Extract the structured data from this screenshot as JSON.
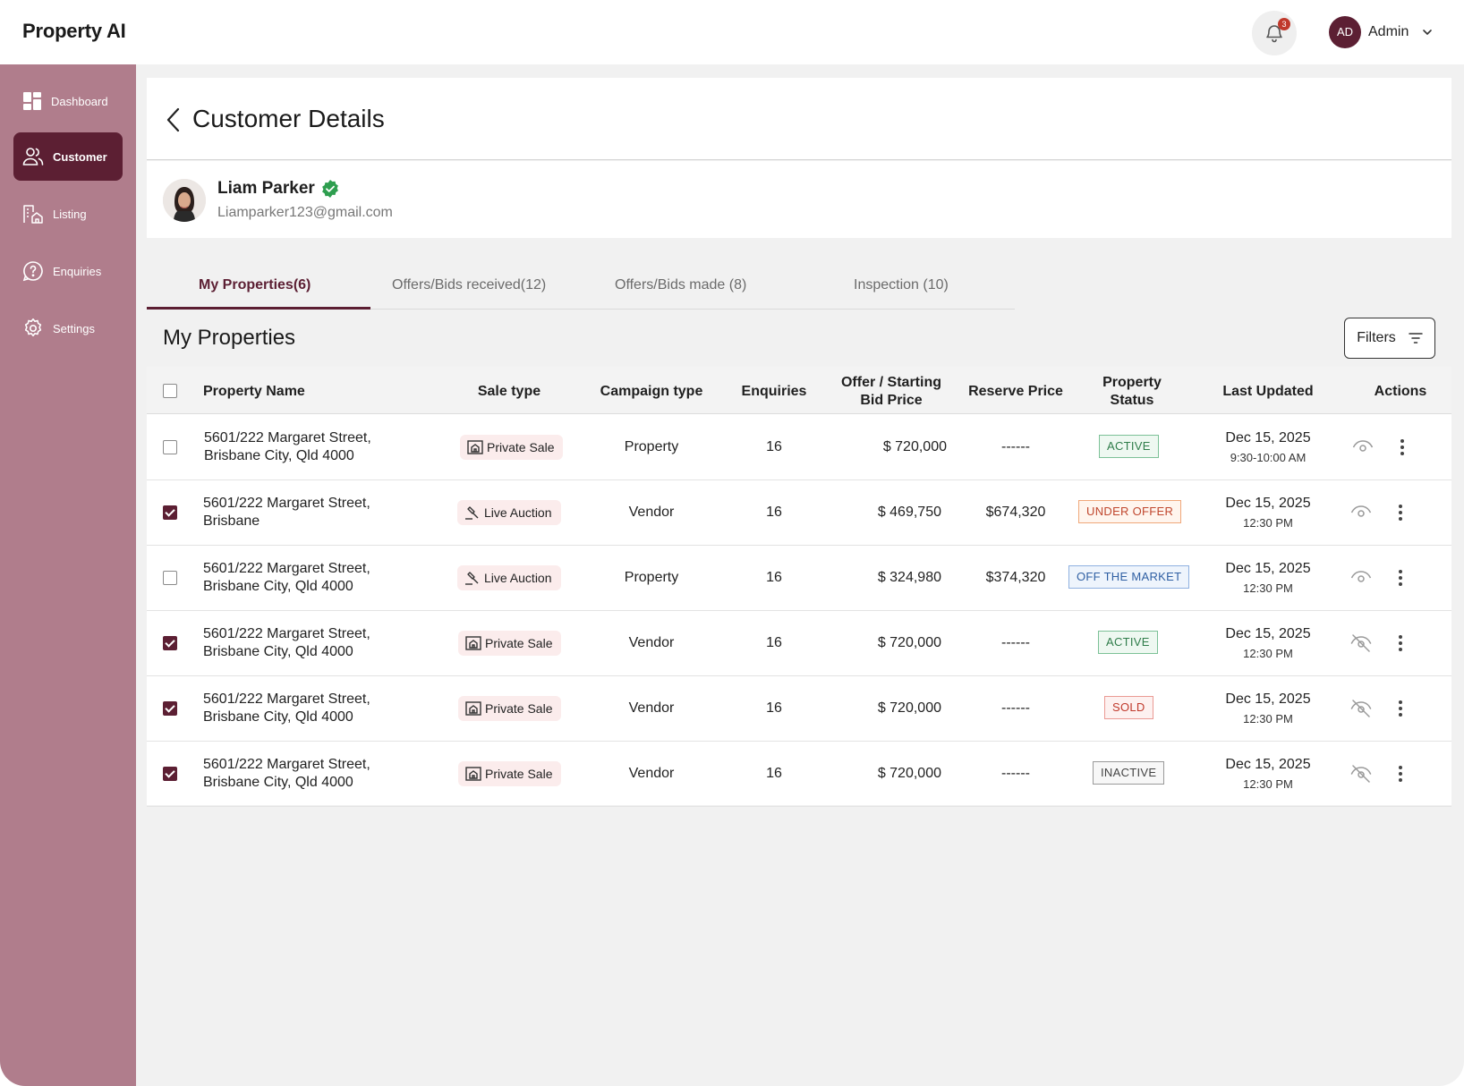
{
  "app": {
    "title": "Property AI"
  },
  "header": {
    "notification_count": "3",
    "user_initials": "AD",
    "user_name": "Admin"
  },
  "sidebar": {
    "items": [
      {
        "label": "Dashboard",
        "icon": "dashboard-icon",
        "active": false
      },
      {
        "label": "Customer",
        "icon": "users-icon",
        "active": true
      },
      {
        "label": "Listing",
        "icon": "building-icon",
        "active": false
      },
      {
        "label": "Enquiries",
        "icon": "question-icon",
        "active": false
      },
      {
        "label": "Settings",
        "icon": "gear-icon",
        "active": false
      }
    ]
  },
  "page": {
    "title": "Customer Details"
  },
  "customer": {
    "name": "Liam Parker",
    "email": "Liamparker123@gmail.com",
    "verified": true
  },
  "tabs": [
    {
      "label": "My Properties(6)",
      "active": true
    },
    {
      "label": "Offers/Bids received(12)",
      "active": false
    },
    {
      "label": "Offers/Bids made (8)",
      "active": false
    },
    {
      "label": "Inspection (10)",
      "active": false
    }
  ],
  "section": {
    "title": "My Properties",
    "filters_label": "Filters"
  },
  "table": {
    "headers": {
      "property_name": "Property Name",
      "sale_type": "Sale type",
      "campaign_type": "Campaign type",
      "enquiries": "Enquiries",
      "offer_line1": "Offer / Starting",
      "offer_line2": "Bid Price",
      "reserve_price": "Reserve Price",
      "status_line1": "Property",
      "status_line2": "Status",
      "last_updated": "Last Updated",
      "actions": "Actions"
    },
    "rows": [
      {
        "checked": false,
        "name1": "5601/222 Margaret Street,",
        "name2": "Brisbane City, Qld 4000",
        "sale_type": "Private Sale",
        "sale_icon": "house-icon",
        "campaign": "Property",
        "enquiries": "16",
        "offer": "$ 720,000",
        "reserve": "------",
        "status": "ACTIVE",
        "status_kind": "active",
        "date": "Dec 15, 2025",
        "time": "9:30-10:00 AM",
        "visible": true
      },
      {
        "checked": true,
        "name1": "5601/222 Margaret Street,",
        "name2": "Brisbane",
        "sale_type": "Live Auction",
        "sale_icon": "gavel-icon",
        "campaign": "Vendor",
        "enquiries": "16",
        "offer": "$ 469,750",
        "reserve": "$674,320",
        "status": "UNDER OFFER",
        "status_kind": "under",
        "date": "Dec 15, 2025",
        "time": "12:30 PM",
        "visible": true
      },
      {
        "checked": false,
        "name1": "5601/222 Margaret Street,",
        "name2": "Brisbane City, Qld 4000",
        "sale_type": "Live Auction",
        "sale_icon": "gavel-icon",
        "campaign": "Property",
        "enquiries": "16",
        "offer": "$ 324,980",
        "reserve": "$374,320",
        "status": "OFF THE MARKET",
        "status_kind": "off",
        "date": "Dec 15, 2025",
        "time": "12:30 PM",
        "visible": true
      },
      {
        "checked": true,
        "name1": "5601/222 Margaret Street,",
        "name2": "Brisbane City, Qld 4000",
        "sale_type": "Private Sale",
        "sale_icon": "house-icon",
        "campaign": "Vendor",
        "enquiries": "16",
        "offer": "$ 720,000",
        "reserve": "------",
        "status": "ACTIVE",
        "status_kind": "active",
        "date": "Dec 15, 2025",
        "time": "12:30 PM",
        "visible": false
      },
      {
        "checked": true,
        "name1": "5601/222 Margaret Street,",
        "name2": "Brisbane City, Qld 4000",
        "sale_type": "Private Sale",
        "sale_icon": "house-icon",
        "campaign": "Vendor",
        "enquiries": "16",
        "offer": "$ 720,000",
        "reserve": "------",
        "status": "SOLD",
        "status_kind": "sold",
        "date": "Dec 15, 2025",
        "time": "12:30 PM",
        "visible": false
      },
      {
        "checked": true,
        "name1": "5601/222 Margaret Street,",
        "name2": "Brisbane City, Qld 4000",
        "sale_type": "Private Sale",
        "sale_icon": "house-icon",
        "campaign": "Vendor",
        "enquiries": "16",
        "offer": "$ 720,000",
        "reserve": "------",
        "status": "INACTIVE",
        "status_kind": "inactive",
        "date": "Dec 15, 2025",
        "time": "12:30 PM",
        "visible": false
      }
    ]
  },
  "colors": {
    "accent": "#5c1f33",
    "sidebar": "#b07d8c",
    "verified": "#2e9e4f"
  }
}
